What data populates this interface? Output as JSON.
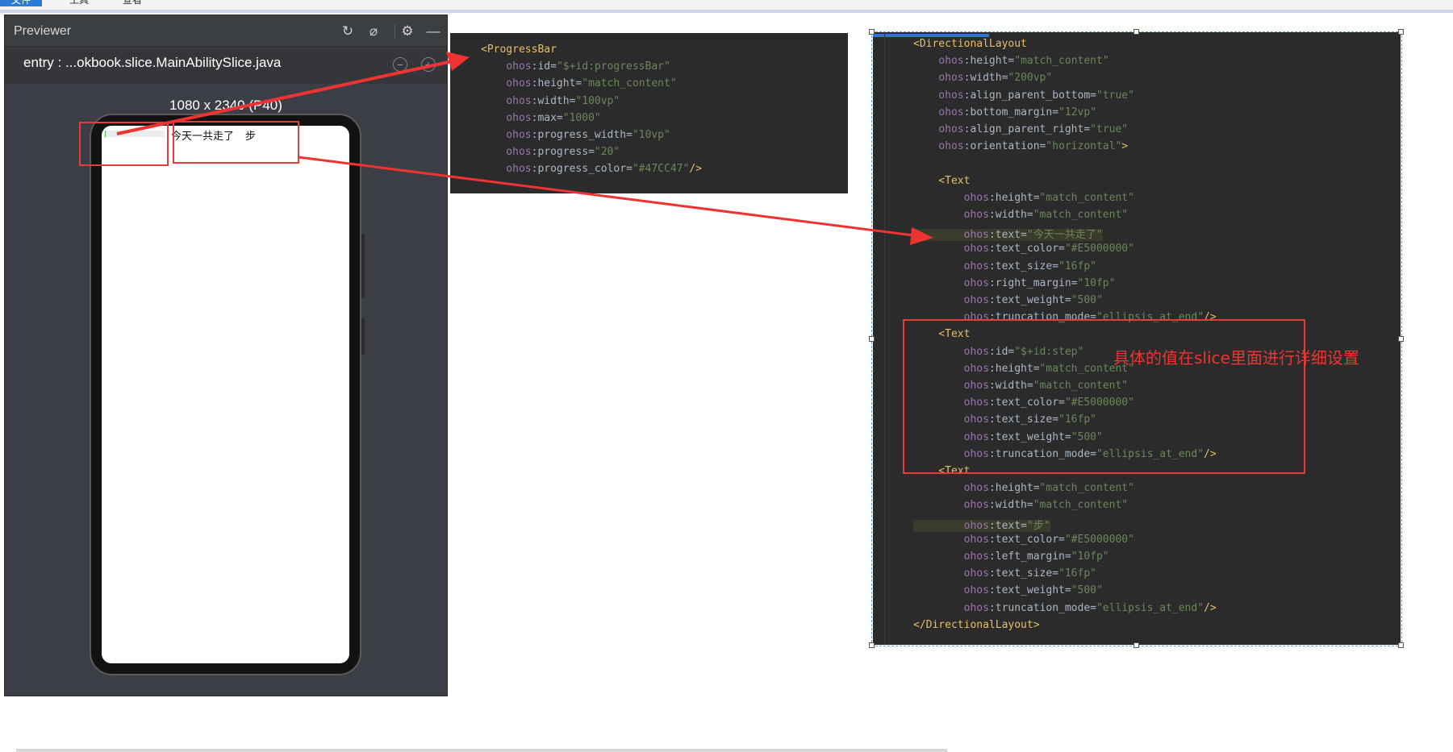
{
  "menubar": {
    "tabs": [
      "文件",
      "工具",
      "查看"
    ]
  },
  "previewer": {
    "title": "Previewer",
    "entry": "entry : ...okbook.slice.MainAbilitySlice.java",
    "resolution": "1080 x 2340 (P40)",
    "icons": [
      "refresh-icon",
      "plugin-icon",
      "gear-icon",
      "minimize-icon",
      "zoom-out-icon",
      "zoom-in-icon"
    ],
    "app": {
      "progress": 20,
      "max": 1000,
      "progress_color": "#47CC47",
      "text1": "今天一共走了",
      "text2": "步"
    }
  },
  "code_panel_1": {
    "lines": [
      [
        [
          "tag",
          "<ProgressBar"
        ]
      ],
      [
        [
          "attr",
          "    ohos"
        ],
        [
          "punc",
          ":id="
        ],
        [
          "val",
          "\"$+id:progressBar\""
        ]
      ],
      [
        [
          "attr",
          "    ohos"
        ],
        [
          "punc",
          ":height="
        ],
        [
          "val",
          "\"match_content\""
        ]
      ],
      [
        [
          "attr",
          "    ohos"
        ],
        [
          "punc",
          ":width="
        ],
        [
          "val",
          "\"100vp\""
        ]
      ],
      [
        [
          "attr",
          "    ohos"
        ],
        [
          "punc",
          ":max="
        ],
        [
          "val",
          "\"1000\""
        ]
      ],
      [
        [
          "attr",
          "    ohos"
        ],
        [
          "punc",
          ":progress_width="
        ],
        [
          "val",
          "\"10vp\""
        ]
      ],
      [
        [
          "attr",
          "    ohos"
        ],
        [
          "punc",
          ":progress="
        ],
        [
          "val",
          "\"20\""
        ]
      ],
      [
        [
          "attr",
          "    ohos"
        ],
        [
          "punc",
          ":progress_color="
        ],
        [
          "val",
          "\"#47CC47\""
        ],
        [
          "tag",
          "/>"
        ]
      ]
    ]
  },
  "code_panel_2": {
    "lines": [
      [
        [
          "tag",
          "<DirectionalLayout"
        ]
      ],
      [
        [
          "attr",
          "    ohos"
        ],
        [
          "punc",
          ":height="
        ],
        [
          "val",
          "\"match_content\""
        ]
      ],
      [
        [
          "attr",
          "    ohos"
        ],
        [
          "punc",
          ":width="
        ],
        [
          "val",
          "\"200vp\""
        ]
      ],
      [
        [
          "attr",
          "    ohos"
        ],
        [
          "punc",
          ":align_parent_bottom="
        ],
        [
          "val",
          "\"true\""
        ]
      ],
      [
        [
          "attr",
          "    ohos"
        ],
        [
          "punc",
          ":bottom_margin="
        ],
        [
          "val",
          "\"12vp\""
        ]
      ],
      [
        [
          "attr",
          "    ohos"
        ],
        [
          "punc",
          ":align_parent_right="
        ],
        [
          "val",
          "\"true\""
        ]
      ],
      [
        [
          "attr",
          "    ohos"
        ],
        [
          "punc",
          ":orientation="
        ],
        [
          "val",
          "\"horizontal\""
        ],
        [
          "tag",
          ">"
        ]
      ],
      [
        [
          "punc",
          ""
        ]
      ],
      [
        [
          "tag",
          "    <Text"
        ]
      ],
      [
        [
          "attr",
          "        ohos"
        ],
        [
          "punc",
          ":height="
        ],
        [
          "val",
          "\"match_content\""
        ]
      ],
      [
        [
          "attr",
          "        ohos"
        ],
        [
          "punc",
          ":width="
        ],
        [
          "val",
          "\"match_content\""
        ]
      ],
      [
        [
          "attrhl",
          "        ohos"
        ],
        [
          "punchl",
          ":text="
        ],
        [
          "valhl",
          "\"今天一共走了\""
        ]
      ],
      [
        [
          "attr",
          "        ohos"
        ],
        [
          "punc",
          ":text_color="
        ],
        [
          "val",
          "\"#E5000000\""
        ]
      ],
      [
        [
          "attr",
          "        ohos"
        ],
        [
          "punc",
          ":text_size="
        ],
        [
          "val",
          "\"16fp\""
        ]
      ],
      [
        [
          "attr",
          "        ohos"
        ],
        [
          "punc",
          ":right_margin="
        ],
        [
          "val",
          "\"10fp\""
        ]
      ],
      [
        [
          "attr",
          "        ohos"
        ],
        [
          "punc",
          ":text_weight="
        ],
        [
          "val",
          "\"500\""
        ]
      ],
      [
        [
          "attr",
          "        ohos"
        ],
        [
          "punc",
          ":truncation_mode="
        ],
        [
          "val",
          "\"ellipsis_at_end\""
        ],
        [
          "tag",
          "/>"
        ]
      ],
      [
        [
          "tag",
          "    <Text"
        ]
      ],
      [
        [
          "attr",
          "        ohos"
        ],
        [
          "punc",
          ":id="
        ],
        [
          "val",
          "\"$+id:step\""
        ]
      ],
      [
        [
          "attr",
          "        ohos"
        ],
        [
          "punc",
          ":height="
        ],
        [
          "val",
          "\"match_content\""
        ]
      ],
      [
        [
          "attr",
          "        ohos"
        ],
        [
          "punc",
          ":width="
        ],
        [
          "val",
          "\"match_content\""
        ]
      ],
      [
        [
          "attr",
          "        ohos"
        ],
        [
          "punc",
          ":text_color="
        ],
        [
          "val",
          "\"#E5000000\""
        ]
      ],
      [
        [
          "attr",
          "        ohos"
        ],
        [
          "punc",
          ":text_size="
        ],
        [
          "val",
          "\"16fp\""
        ]
      ],
      [
        [
          "attr",
          "        ohos"
        ],
        [
          "punc",
          ":text_weight="
        ],
        [
          "val",
          "\"500\""
        ]
      ],
      [
        [
          "attr",
          "        ohos"
        ],
        [
          "punc",
          ":truncation_mode="
        ],
        [
          "val",
          "\"ellipsis_at_end\""
        ],
        [
          "tag",
          "/>"
        ]
      ],
      [
        [
          "tag",
          "    <Text"
        ]
      ],
      [
        [
          "attr",
          "        ohos"
        ],
        [
          "punc",
          ":height="
        ],
        [
          "val",
          "\"match_content\""
        ]
      ],
      [
        [
          "attr",
          "        ohos"
        ],
        [
          "punc",
          ":width="
        ],
        [
          "val",
          "\"match_content\""
        ]
      ],
      [
        [
          "attrhl",
          "        ohos"
        ],
        [
          "punchl",
          ":text="
        ],
        [
          "valhl",
          "\"步\""
        ]
      ],
      [
        [
          "attr",
          "        ohos"
        ],
        [
          "punc",
          ":text_color="
        ],
        [
          "val",
          "\"#E5000000\""
        ]
      ],
      [
        [
          "attr",
          "        ohos"
        ],
        [
          "punc",
          ":left_margin="
        ],
        [
          "val",
          "\"10fp\""
        ]
      ],
      [
        [
          "attr",
          "        ohos"
        ],
        [
          "punc",
          ":text_size="
        ],
        [
          "val",
          "\"16fp\""
        ]
      ],
      [
        [
          "attr",
          "        ohos"
        ],
        [
          "punc",
          ":text_weight="
        ],
        [
          "val",
          "\"500\""
        ]
      ],
      [
        [
          "attr",
          "        ohos"
        ],
        [
          "punc",
          ":truncation_mode="
        ],
        [
          "val",
          "\"ellipsis_at_end\""
        ],
        [
          "tag",
          "/>"
        ]
      ],
      [
        [
          "tag",
          "</DirectionalLayout>"
        ]
      ]
    ]
  },
  "annotation": {
    "callout": "具体的值在slice里面进行详细设置",
    "arrow_color": "#ee3333"
  }
}
